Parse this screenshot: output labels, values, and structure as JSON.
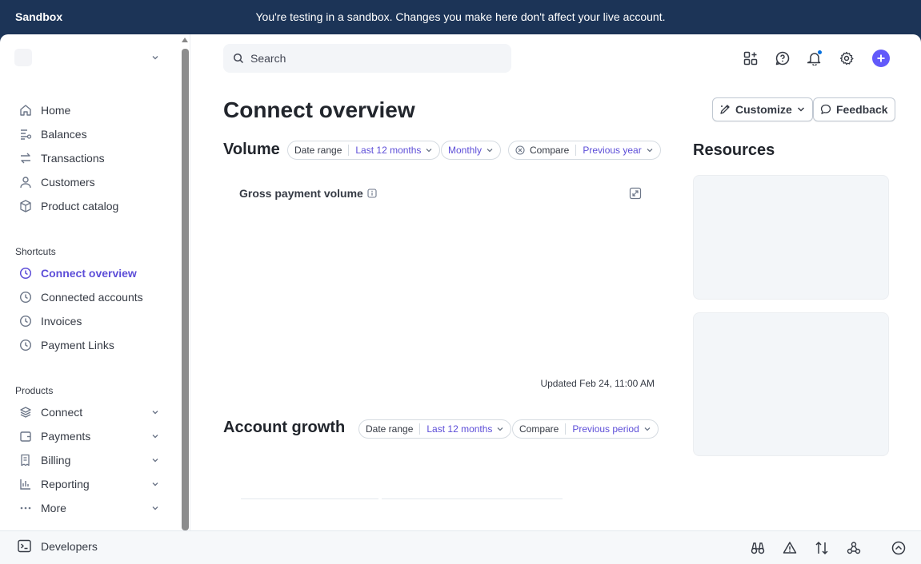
{
  "banner": {
    "label": "Sandbox",
    "message": "You're testing in a sandbox. Changes you make here don't affect your live account."
  },
  "sidebar": {
    "nav": [
      {
        "label": "Home",
        "icon": "home-icon"
      },
      {
        "label": "Balances",
        "icon": "balances-icon"
      },
      {
        "label": "Transactions",
        "icon": "transactions-icon"
      },
      {
        "label": "Customers",
        "icon": "customers-icon"
      },
      {
        "label": "Product catalog",
        "icon": "product-catalog-icon"
      }
    ],
    "shortcuts_title": "Shortcuts",
    "shortcuts": [
      {
        "label": "Connect overview",
        "active": true
      },
      {
        "label": "Connected accounts",
        "active": false
      },
      {
        "label": "Invoices",
        "active": false
      },
      {
        "label": "Payment Links",
        "active": false
      }
    ],
    "products_title": "Products",
    "products": [
      {
        "label": "Connect",
        "icon": "connect-icon"
      },
      {
        "label": "Payments",
        "icon": "payments-icon"
      },
      {
        "label": "Billing",
        "icon": "billing-icon"
      },
      {
        "label": "Reporting",
        "icon": "reporting-icon"
      },
      {
        "label": "More",
        "icon": "more-icon"
      }
    ]
  },
  "bottombar": {
    "developers_label": "Developers"
  },
  "header": {
    "search_placeholder": "Search"
  },
  "page": {
    "title": "Connect overview",
    "customize_label": "Customize",
    "feedback_label": "Feedback"
  },
  "volume": {
    "title": "Volume",
    "date_range_key": "Date range",
    "date_range_value": "Last 12 months",
    "interval_value": "Monthly",
    "compare_key": "Compare",
    "compare_value": "Previous year",
    "card_title": "Gross payment volume",
    "updated": "Updated Feb 24, 11:00 AM"
  },
  "growth": {
    "title": "Account growth",
    "date_range_key": "Date range",
    "date_range_value": "Last 12 months",
    "compare_key": "Compare",
    "compare_value": "Previous period"
  },
  "resources": {
    "title": "Resources"
  },
  "colors": {
    "accent": "#5d4ed8",
    "banner": "#1c3457",
    "primary_button": "#625afa"
  }
}
